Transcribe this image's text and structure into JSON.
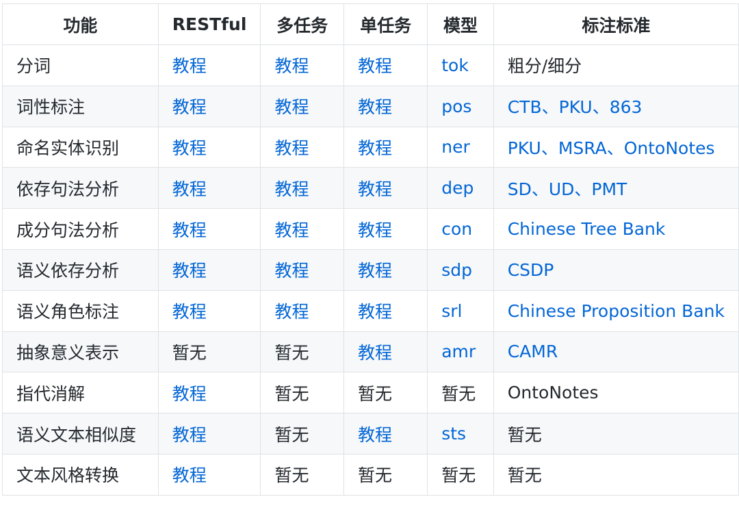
{
  "headers": [
    "功能",
    "RESTful",
    "多任务",
    "单任务",
    "模型",
    "标注标准"
  ],
  "rows": [
    [
      {
        "t": "分词",
        "l": false
      },
      {
        "t": "教程",
        "l": true
      },
      {
        "t": "教程",
        "l": true
      },
      {
        "t": "教程",
        "l": true
      },
      {
        "t": "tok",
        "l": true
      },
      {
        "t": "粗分/细分",
        "l": false
      }
    ],
    [
      {
        "t": "词性标注",
        "l": false
      },
      {
        "t": "教程",
        "l": true
      },
      {
        "t": "教程",
        "l": true
      },
      {
        "t": "教程",
        "l": true
      },
      {
        "t": "pos",
        "l": true
      },
      {
        "t": "CTB、PKU、863",
        "l": true
      }
    ],
    [
      {
        "t": "命名实体识别",
        "l": false
      },
      {
        "t": "教程",
        "l": true
      },
      {
        "t": "教程",
        "l": true
      },
      {
        "t": "教程",
        "l": true
      },
      {
        "t": "ner",
        "l": true
      },
      {
        "t": "PKU、MSRA、OntoNotes",
        "l": true
      }
    ],
    [
      {
        "t": "依存句法分析",
        "l": false
      },
      {
        "t": "教程",
        "l": true
      },
      {
        "t": "教程",
        "l": true
      },
      {
        "t": "教程",
        "l": true
      },
      {
        "t": "dep",
        "l": true
      },
      {
        "t": "SD、UD、PMT",
        "l": true
      }
    ],
    [
      {
        "t": "成分句法分析",
        "l": false
      },
      {
        "t": "教程",
        "l": true
      },
      {
        "t": "教程",
        "l": true
      },
      {
        "t": "教程",
        "l": true
      },
      {
        "t": "con",
        "l": true
      },
      {
        "t": "Chinese Tree Bank",
        "l": true
      }
    ],
    [
      {
        "t": "语义依存分析",
        "l": false
      },
      {
        "t": "教程",
        "l": true
      },
      {
        "t": "教程",
        "l": true
      },
      {
        "t": "教程",
        "l": true
      },
      {
        "t": "sdp",
        "l": true
      },
      {
        "t": "CSDP",
        "l": true
      }
    ],
    [
      {
        "t": "语义角色标注",
        "l": false
      },
      {
        "t": "教程",
        "l": true
      },
      {
        "t": "教程",
        "l": true
      },
      {
        "t": "教程",
        "l": true
      },
      {
        "t": "srl",
        "l": true
      },
      {
        "t": "Chinese Proposition Bank",
        "l": true
      }
    ],
    [
      {
        "t": "抽象意义表示",
        "l": false
      },
      {
        "t": "暂无",
        "l": false
      },
      {
        "t": "暂无",
        "l": false
      },
      {
        "t": "教程",
        "l": true
      },
      {
        "t": "amr",
        "l": true
      },
      {
        "t": "CAMR",
        "l": true
      }
    ],
    [
      {
        "t": "指代消解",
        "l": false
      },
      {
        "t": "教程",
        "l": true
      },
      {
        "t": "暂无",
        "l": false
      },
      {
        "t": "暂无",
        "l": false
      },
      {
        "t": "暂无",
        "l": false
      },
      {
        "t": "OntoNotes",
        "l": false
      }
    ],
    [
      {
        "t": "语义文本相似度",
        "l": false
      },
      {
        "t": "教程",
        "l": true
      },
      {
        "t": "暂无",
        "l": false
      },
      {
        "t": "教程",
        "l": true
      },
      {
        "t": "sts",
        "l": true
      },
      {
        "t": "暂无",
        "l": false
      }
    ],
    [
      {
        "t": "文本风格转换",
        "l": false
      },
      {
        "t": "教程",
        "l": true
      },
      {
        "t": "暂无",
        "l": false
      },
      {
        "t": "暂无",
        "l": false
      },
      {
        "t": "暂无",
        "l": false
      },
      {
        "t": "暂无",
        "l": false
      }
    ]
  ],
  "colors": {
    "link": "#0366d6",
    "text": "#24292e",
    "border": "#dfe2e5",
    "stripe": "#f6f8fa"
  }
}
